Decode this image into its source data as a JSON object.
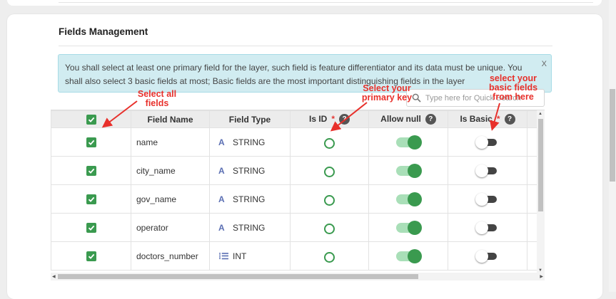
{
  "page": {
    "title": "Fields Management",
    "alert_text": "You shall select at least one primary field for the layer, such field is feature differentiator and its data must be unique. You shall also select 3 basic fields at most; Basic fields are the most important distinguishing fields in the layer",
    "alert_close": "X"
  },
  "search": {
    "placeholder": "Type here for Quick Search",
    "icon": "search-icon"
  },
  "annotations": {
    "select_all": "Select all fields",
    "primary_key": "Select your primary key",
    "basic_fields": "select your basic fields from here"
  },
  "table": {
    "headers": {
      "field_name": "Field Name",
      "field_type": "Field Type",
      "is_id": "Is ID",
      "allow_null": "Allow null",
      "is_basic": "Is Basic",
      "required_mark": "*",
      "help_mark": "?"
    },
    "select_all_checked": true,
    "rows": [
      {
        "selected": true,
        "name": "name",
        "type_icon": "A",
        "type": "STRING",
        "is_id": false,
        "allow_null": true,
        "is_basic": false
      },
      {
        "selected": true,
        "name": "city_name",
        "type_icon": "A",
        "type": "STRING",
        "is_id": false,
        "allow_null": true,
        "is_basic": false
      },
      {
        "selected": true,
        "name": "gov_name",
        "type_icon": "A",
        "type": "STRING",
        "is_id": false,
        "allow_null": true,
        "is_basic": false
      },
      {
        "selected": true,
        "name": "operator",
        "type_icon": "A",
        "type": "STRING",
        "is_id": false,
        "allow_null": true,
        "is_basic": false
      },
      {
        "selected": true,
        "name": "doctors_number",
        "type_icon": "⁞☰",
        "type": "INT",
        "is_id": false,
        "allow_null": true,
        "is_basic": false
      }
    ]
  },
  "colors": {
    "accent_green": "#3a9a4f",
    "annotation_red": "#e8302b",
    "alert_bg": "#d1ecf1"
  }
}
